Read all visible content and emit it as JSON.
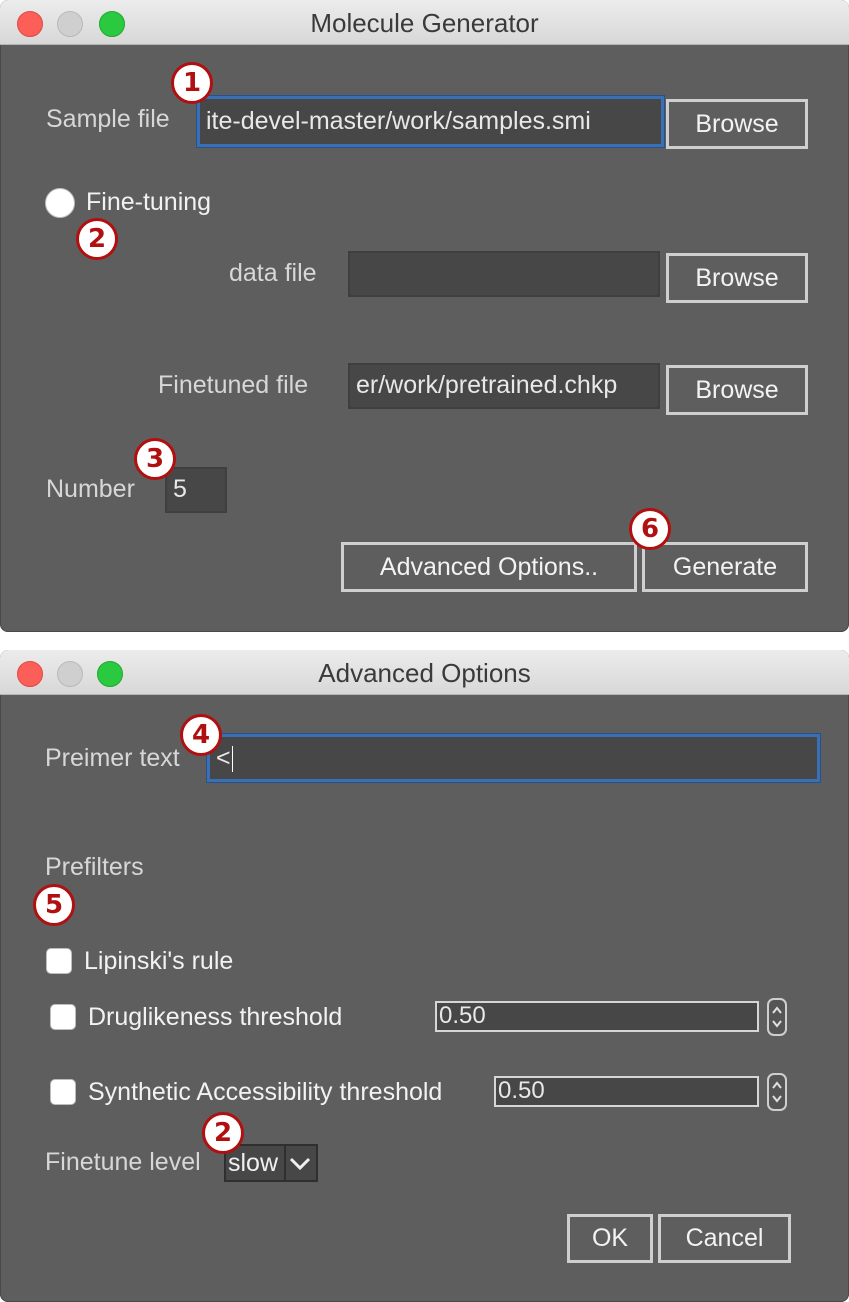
{
  "window1": {
    "title": "Molecule Generator",
    "sample_file_label": "Sample file",
    "sample_file_value": "ite-devel-master/work/samples.smi",
    "fine_tuning_label": "Fine-tuning",
    "data_file_label": "data file",
    "data_file_value": "",
    "finetuned_file_label": "Finetuned file",
    "finetuned_file_value": "er/work/pretrained.chkp",
    "browse_label": "Browse",
    "number_label": "Number",
    "number_value": "5",
    "advanced_button": "Advanced Options..",
    "generate_button": "Generate"
  },
  "window2": {
    "title": "Advanced Options",
    "preimer_label": "Preimer text",
    "preimer_value": "<",
    "prefilters_label": "Prefilters",
    "lipinski_label": "Lipinski's rule",
    "druglikeness_label": "Druglikeness threshold",
    "druglikeness_value": "0.50",
    "synthetic_label": "Synthetic Accessibility threshold",
    "synthetic_value": "0.50",
    "finetune_level_label": "Finetune level",
    "finetune_level_value": "slow",
    "ok_button": "OK",
    "cancel_button": "Cancel"
  },
  "badges": {
    "b1": "1",
    "b2": "2",
    "b3": "3",
    "b4": "4",
    "b5": "5",
    "b6": "6",
    "b2b": "2"
  },
  "colors": {
    "window_bg": "#5e5e5e",
    "focus_ring": "#3b6fb3",
    "badge_red": "#b01010",
    "close": "#fc5f57",
    "maximize": "#2ac940"
  },
  "icons": [
    "close-button",
    "minimize-button",
    "maximize-button",
    "chevron-down-icon",
    "stepper-arrows-icon"
  ]
}
